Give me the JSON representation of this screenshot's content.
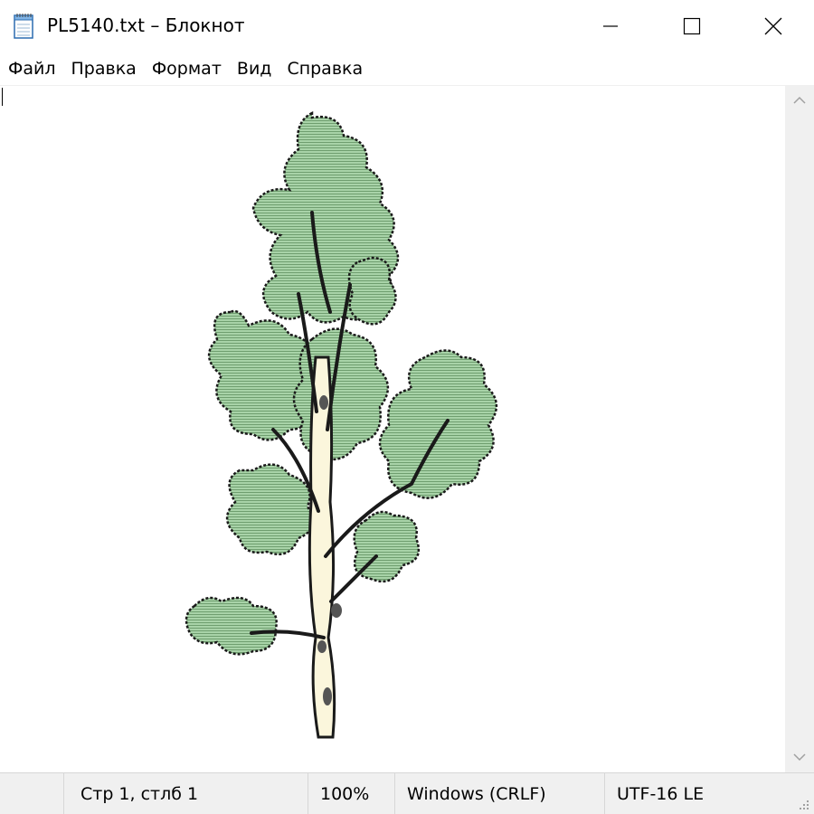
{
  "window": {
    "title": "PL5140.txt – Блокнот",
    "app_icon": "notepad-icon",
    "buttons": {
      "minimize_icon": "minimize-icon",
      "maximize_icon": "maximize-icon",
      "close_icon": "close-icon"
    }
  },
  "menu": {
    "items": [
      {
        "label": "Файл"
      },
      {
        "label": "Правка"
      },
      {
        "label": "Формат"
      },
      {
        "label": "Вид"
      },
      {
        "label": "Справка"
      }
    ]
  },
  "editor": {
    "content_description_icon": "tree-ascii-art",
    "colors": {
      "foliage": "#a8d3a8",
      "outline": "#1a1a1a",
      "trunk": "#fbf6dc"
    }
  },
  "scrollbar": {
    "up_icon": "chevron-up-icon",
    "down_icon": "chevron-down-icon"
  },
  "status": {
    "position": "Стр 1, стлб 1",
    "zoom": "100%",
    "line_endings": "Windows (CRLF)",
    "encoding": "UTF-16 LE"
  }
}
